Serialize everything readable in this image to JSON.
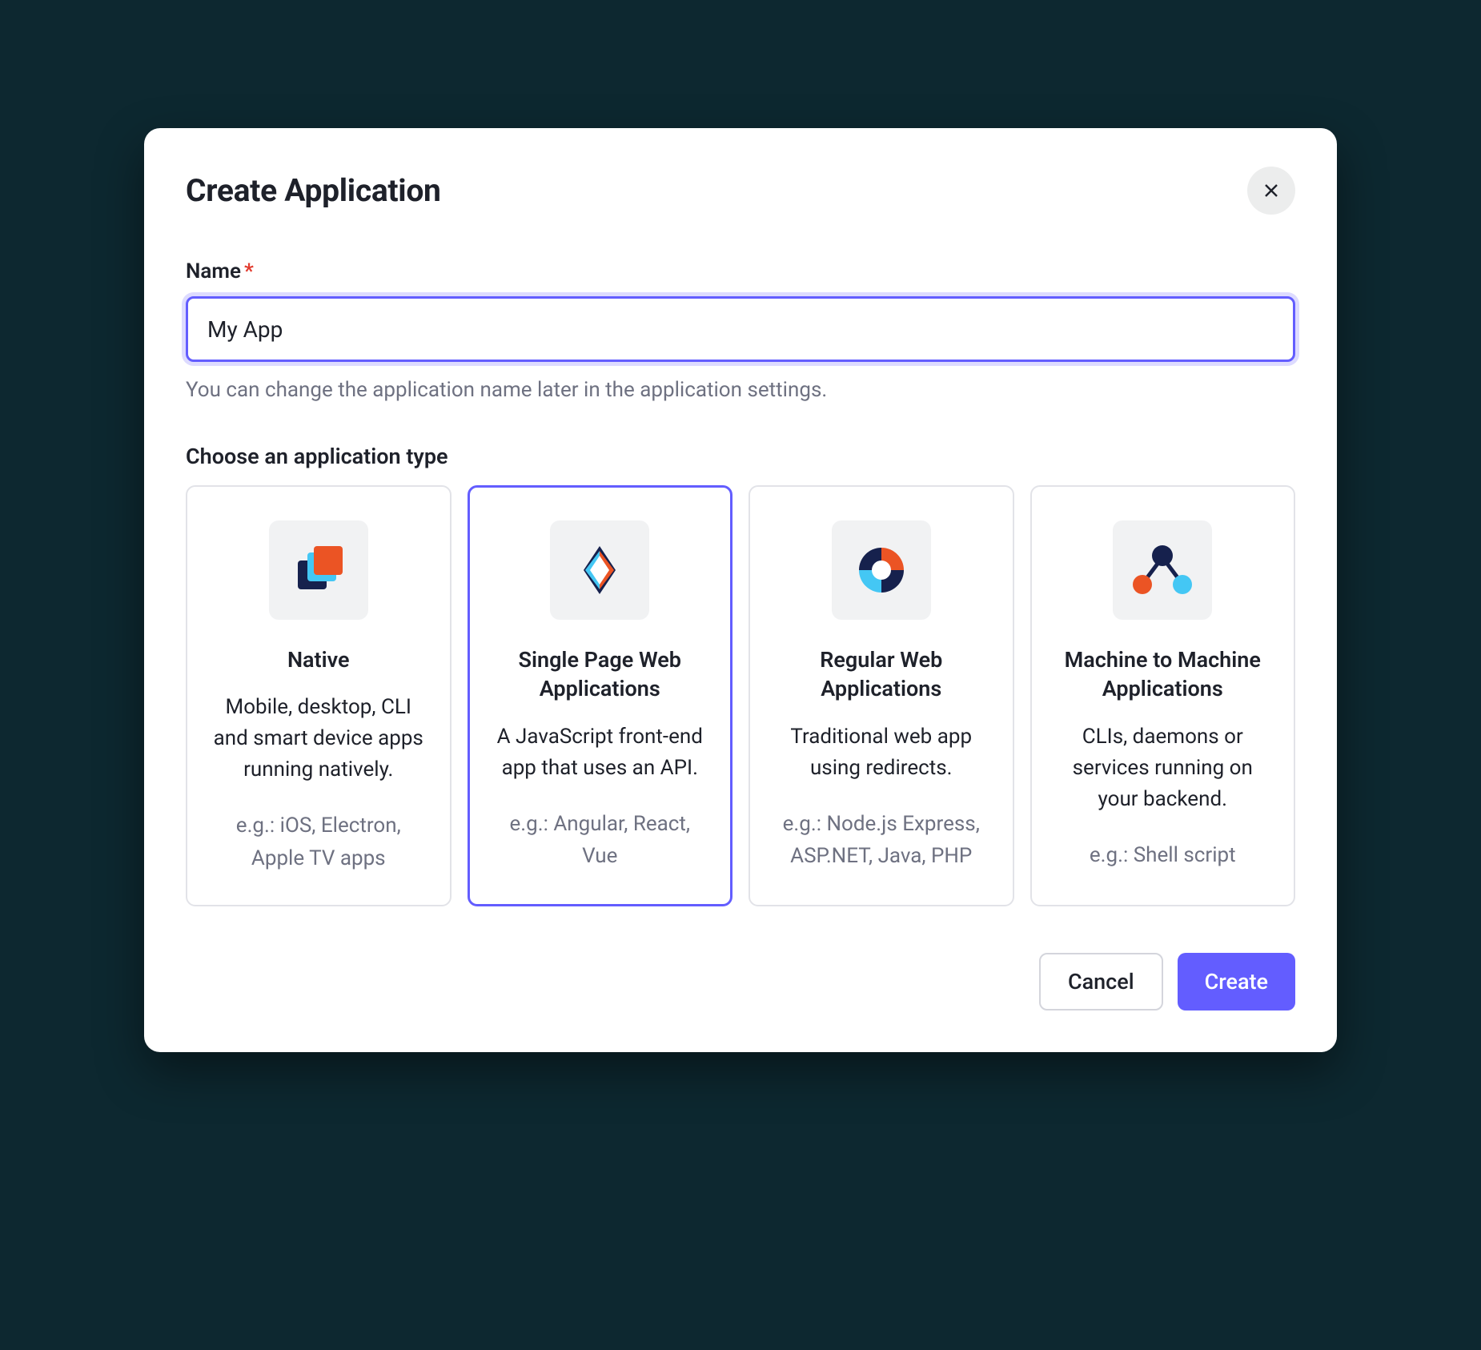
{
  "modal": {
    "title": "Create Application"
  },
  "name_field": {
    "label": "Name",
    "value": "My App",
    "hint": "You can change the application name later in the application settings."
  },
  "type_section": {
    "label": "Choose an application type",
    "selected_index": 1,
    "types": [
      {
        "title": "Native",
        "desc": "Mobile, desktop, CLI and smart device apps running natively.",
        "eg": "e.g.: iOS, Electron, Apple TV apps"
      },
      {
        "title": "Single Page Web Applications",
        "desc": "A JavaScript front-end app that uses an API.",
        "eg": "e.g.: Angular, React, Vue"
      },
      {
        "title": "Regular Web Applications",
        "desc": "Traditional web app using redirects.",
        "eg": "e.g.: Node.js Express, ASP.NET, Java, PHP"
      },
      {
        "title": "Machine to Machine Applications",
        "desc": "CLIs, daemons or services running on your backend.",
        "eg": "e.g.: Shell script"
      }
    ]
  },
  "footer": {
    "cancel": "Cancel",
    "create": "Create"
  },
  "colors": {
    "accent": "#635dff",
    "orange": "#eb5424",
    "lightblue": "#44c7f4",
    "navy": "#16214d"
  }
}
